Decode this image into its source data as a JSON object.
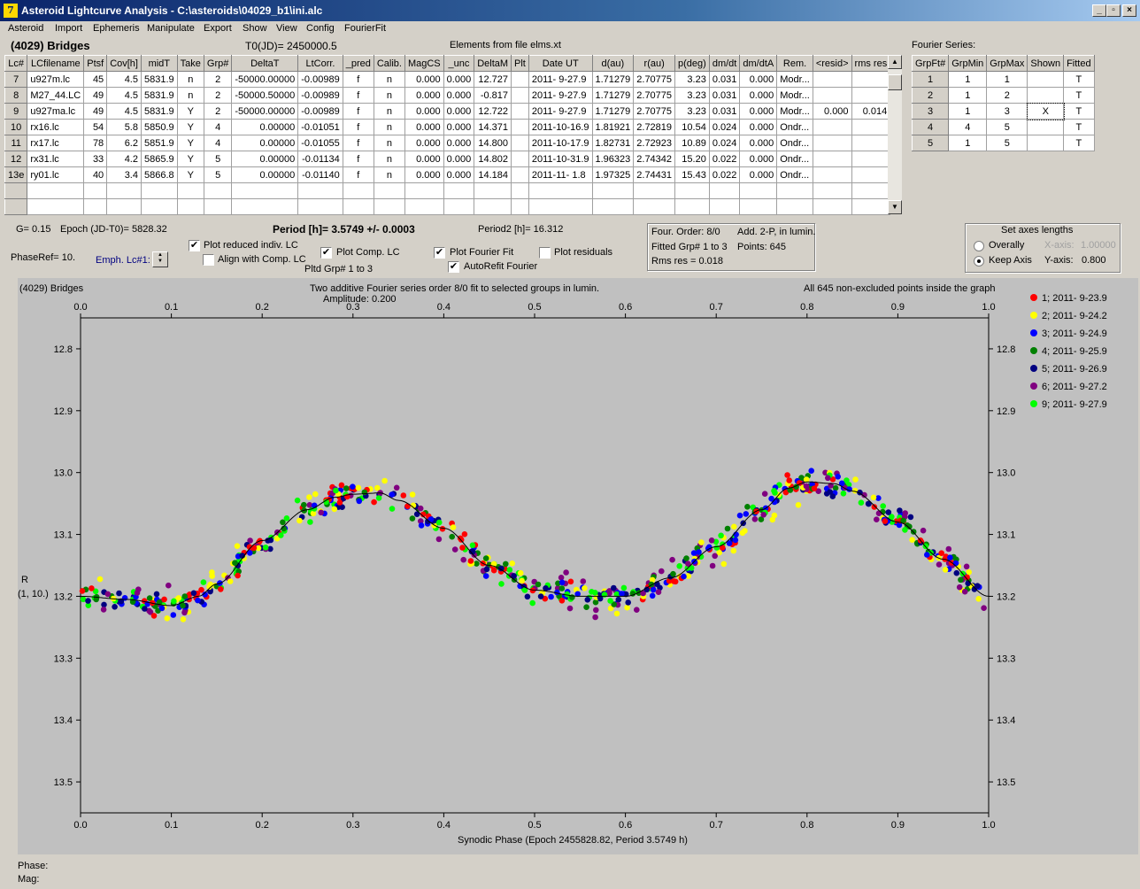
{
  "window": {
    "title": "Asteroid Lightcurve Analysis - C:\\asteroids\\04029_b1\\ini.alc",
    "icon_glyph": "7",
    "min_glyph": "_",
    "max_glyph": "▫",
    "close_glyph": "×"
  },
  "menu": [
    "Asteroid",
    "Import",
    "Ephemeris",
    "Manipulate",
    "Export",
    "Show",
    "View",
    "Config",
    "FourierFit"
  ],
  "header": {
    "object": "(4029) Bridges",
    "t0": "T0(JD)= 2450000.5",
    "elements": "Elements from file elms.xt",
    "fourier_title": "Fourier Series:"
  },
  "lc_table": {
    "columns": [
      "Lc#",
      "LCfilename",
      "Ptsf",
      "Cov[h]",
      "midT",
      "Take",
      "Grp#",
      "DeltaT",
      "LtCorr.",
      "_pred",
      "Calib.",
      "MagCS",
      "_unc",
      "DeltaM",
      "Plt",
      "Date UT",
      "d(au)",
      "r(au)",
      "p(deg)",
      "dm/dt",
      "dm/dtA",
      "Rem.",
      "<resid>",
      "rms res"
    ],
    "rows": [
      [
        "7",
        "u927m.lc",
        "45",
        "4.5",
        "5831.9",
        "n",
        "2",
        "-50000.00000",
        "-0.00989",
        "f",
        "n",
        "0.000",
        "0.000",
        "12.727",
        "",
        "2011- 9-27.9",
        "1.71279",
        "2.70775",
        "3.23",
        "0.031",
        "0.000",
        "Modr...",
        "",
        ""
      ],
      [
        "8",
        "M27_44.LC",
        "49",
        "4.5",
        "5831.9",
        "n",
        "2",
        "-50000.50000",
        "-0.00989",
        "f",
        "n",
        "0.000",
        "0.000",
        "-0.817",
        "",
        "2011- 9-27.9",
        "1.71279",
        "2.70775",
        "3.23",
        "0.031",
        "0.000",
        "Modr...",
        "",
        ""
      ],
      [
        "9",
        "u927ma.lc",
        "49",
        "4.5",
        "5831.9",
        "Y",
        "2",
        "-50000.00000",
        "-0.00989",
        "f",
        "n",
        "0.000",
        "0.000",
        "12.722",
        "",
        "2011- 9-27.9",
        "1.71279",
        "2.70775",
        "3.23",
        "0.031",
        "0.000",
        "Modr...",
        "0.000",
        "0.014"
      ],
      [
        "10",
        "rx16.lc",
        "54",
        "5.8",
        "5850.9",
        "Y",
        "4",
        "0.00000",
        "-0.01051",
        "f",
        "n",
        "0.000",
        "0.000",
        "14.371",
        "",
        "2011-10-16.9",
        "1.81921",
        "2.72819",
        "10.54",
        "0.024",
        "0.000",
        "Ondr...",
        "",
        ""
      ],
      [
        "11",
        "rx17.lc",
        "78",
        "6.2",
        "5851.9",
        "Y",
        "4",
        "0.00000",
        "-0.01055",
        "f",
        "n",
        "0.000",
        "0.000",
        "14.800",
        "",
        "2011-10-17.9",
        "1.82731",
        "2.72923",
        "10.89",
        "0.024",
        "0.000",
        "Ondr...",
        "",
        ""
      ],
      [
        "12",
        "rx31.lc",
        "33",
        "4.2",
        "5865.9",
        "Y",
        "5",
        "0.00000",
        "-0.01134",
        "f",
        "n",
        "0.000",
        "0.000",
        "14.802",
        "",
        "2011-10-31.9",
        "1.96323",
        "2.74342",
        "15.20",
        "0.022",
        "0.000",
        "Ondr...",
        "",
        ""
      ],
      [
        "13e",
        "ry01.lc",
        "40",
        "3.4",
        "5866.8",
        "Y",
        "5",
        "0.00000",
        "-0.01140",
        "f",
        "n",
        "0.000",
        "0.000",
        "14.184",
        "",
        "2011-11- 1.8",
        "1.97325",
        "2.74431",
        "15.43",
        "0.022",
        "0.000",
        "Ondr...",
        "",
        ""
      ]
    ]
  },
  "fourier_table": {
    "columns": [
      "GrpFt#",
      "GrpMin",
      "GrpMax",
      "Shown",
      "Fitted"
    ],
    "rows": [
      [
        "1",
        "1",
        "1",
        "",
        "T"
      ],
      [
        "2",
        "1",
        "2",
        "",
        "T"
      ],
      [
        "3",
        "1",
        "3",
        "X",
        "T"
      ],
      [
        "4",
        "4",
        "5",
        "",
        "T"
      ],
      [
        "5",
        "1",
        "5",
        "",
        "T"
      ]
    ]
  },
  "params": {
    "g": "G= 0.15",
    "epoch": "Epoch (JD-T0)= 5828.32",
    "period": "Period [h]= 3.5749 +/- 0.0003",
    "period2": "Period2 [h]= 16.312",
    "phaseref": "PhaseRef= 10.",
    "emph": "Emph. Lc#1:",
    "pltd_grp": "Pltd Grp#  1   to   3"
  },
  "checks": {
    "plot_reduced": {
      "label": "Plot reduced indiv. LC",
      "checked": true
    },
    "align_comp": {
      "label": "Align with Comp. LC",
      "checked": false
    },
    "plot_comp": {
      "label": "Plot Comp. LC",
      "checked": true
    },
    "plot_fourier": {
      "label": "Plot Fourier Fit",
      "checked": true
    },
    "autorefit": {
      "label": "AutoRefit Fourier",
      "checked": true
    },
    "plot_residuals": {
      "label": "Plot residuals",
      "checked": false
    },
    "check_glyph": "✔"
  },
  "fit_info": {
    "order": "Four. Order:  8/0",
    "add": "Add. 2-P, in lumin.",
    "fitted": "Fitted Grp# 1 to 3",
    "points": "Points: 645",
    "rms": "Rms res    = 0.018"
  },
  "axes_box": {
    "title": "Set axes lengths",
    "overally": "Overally",
    "keep_axis": "Keep Axis",
    "x_axis": "X-axis:",
    "x_val": "1.00000",
    "y_axis": "Y-axis:",
    "y_val": "0.800",
    "selected": "keep_axis"
  },
  "plot": {
    "name": "(4029) Bridges",
    "caption1": "Two additive Fourier series order 8/0 fit to selected groups in lumin.",
    "caption2": "Amplitude: 0.200",
    "note": "All 645 non-excluded points inside the graph",
    "ylabel1": "R",
    "ylabel2": "(1, 10.)",
    "xlabel": "Synodic Phase (Epoch 2455828.82, Period 3.5749 h)"
  },
  "status": {
    "phase": "Phase:",
    "mag": "Mag:"
  },
  "chart_data": {
    "type": "scatter",
    "title": "Two additive Fourier series order 8/0 fit to selected groups in lumin.",
    "xlabel": "Synodic Phase (Epoch 2455828.82, Period 3.5749 h)",
    "ylabel": "R (1, 10.)",
    "xlim": [
      0.0,
      1.0
    ],
    "ylim": [
      12.75,
      13.55
    ],
    "y_inverted": true,
    "x_ticks": [
      "0.0",
      "0.1",
      "0.2",
      "0.3",
      "0.4",
      "0.5",
      "0.6",
      "0.7",
      "0.8",
      "0.9",
      "1.0"
    ],
    "y_ticks": [
      "12.8",
      "12.9",
      "13.0",
      "13.1",
      "13.2",
      "13.3",
      "13.4",
      "13.5"
    ],
    "legend_position": "right",
    "series": [
      {
        "name": "1; 2011- 9-23.9",
        "color": "#ff0000"
      },
      {
        "name": "2; 2011- 9-24.2",
        "color": "#ffff00"
      },
      {
        "name": "3; 2011- 9-24.9",
        "color": "#0000ff"
      },
      {
        "name": "4; 2011- 9-25.9",
        "color": "#008000"
      },
      {
        "name": "5; 2011- 9-26.9",
        "color": "#000080"
      },
      {
        "name": "6; 2011- 9-27.2",
        "color": "#800080"
      },
      {
        "name": "9; 2011- 9-27.9",
        "color": "#00ff00"
      }
    ],
    "fit_curve": {
      "x": [
        0.0,
        0.05,
        0.1,
        0.13,
        0.15,
        0.2,
        0.25,
        0.28,
        0.3,
        0.33,
        0.35,
        0.4,
        0.45,
        0.5,
        0.55,
        0.6,
        0.65,
        0.7,
        0.75,
        0.78,
        0.8,
        0.83,
        0.85,
        0.9,
        0.95,
        1.0
      ],
      "y": [
        13.2,
        13.205,
        13.215,
        13.2,
        13.18,
        13.11,
        13.06,
        13.04,
        13.035,
        13.033,
        13.045,
        13.09,
        13.15,
        13.19,
        13.2,
        13.2,
        13.17,
        13.12,
        13.06,
        13.025,
        13.015,
        13.018,
        13.03,
        13.08,
        13.14,
        13.2
      ]
    },
    "points_total": 645
  }
}
